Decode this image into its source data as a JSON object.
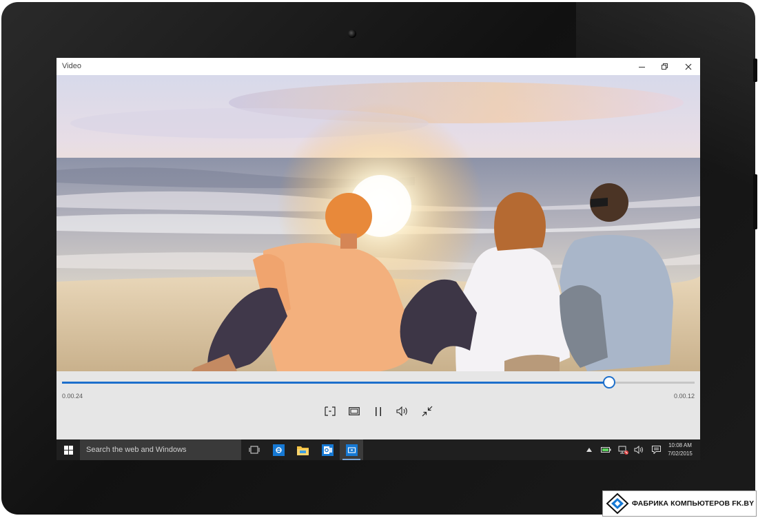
{
  "window": {
    "title": "Video"
  },
  "player": {
    "elapsed": "0.00.24",
    "remaining": "0.00.12",
    "progress_fraction": 0.865,
    "controls": [
      "cast-to-device",
      "aspect-ratio",
      "pause",
      "volume",
      "exit-fullscreen"
    ]
  },
  "taskbar": {
    "search_placeholder": "Search the web and Windows",
    "pinned_apps": [
      "task-view",
      "internet-explorer",
      "file-explorer",
      "outlook",
      "video-app"
    ],
    "active_app": "video-app",
    "tray_icons": [
      "show-hidden-icons",
      "battery",
      "network",
      "volume",
      "action-center"
    ]
  },
  "clock": {
    "time": "10:08 AM",
    "date": "7/02/2015"
  },
  "watermark": {
    "text": "ФАБРИКА КОМПЬЮТЕРОВ FK.BY"
  },
  "colors": {
    "accent": "#1d6fcb",
    "taskbar": "#1f1f1f",
    "app_tile": "#1679d4",
    "controls_bg": "#e6e6e6"
  }
}
